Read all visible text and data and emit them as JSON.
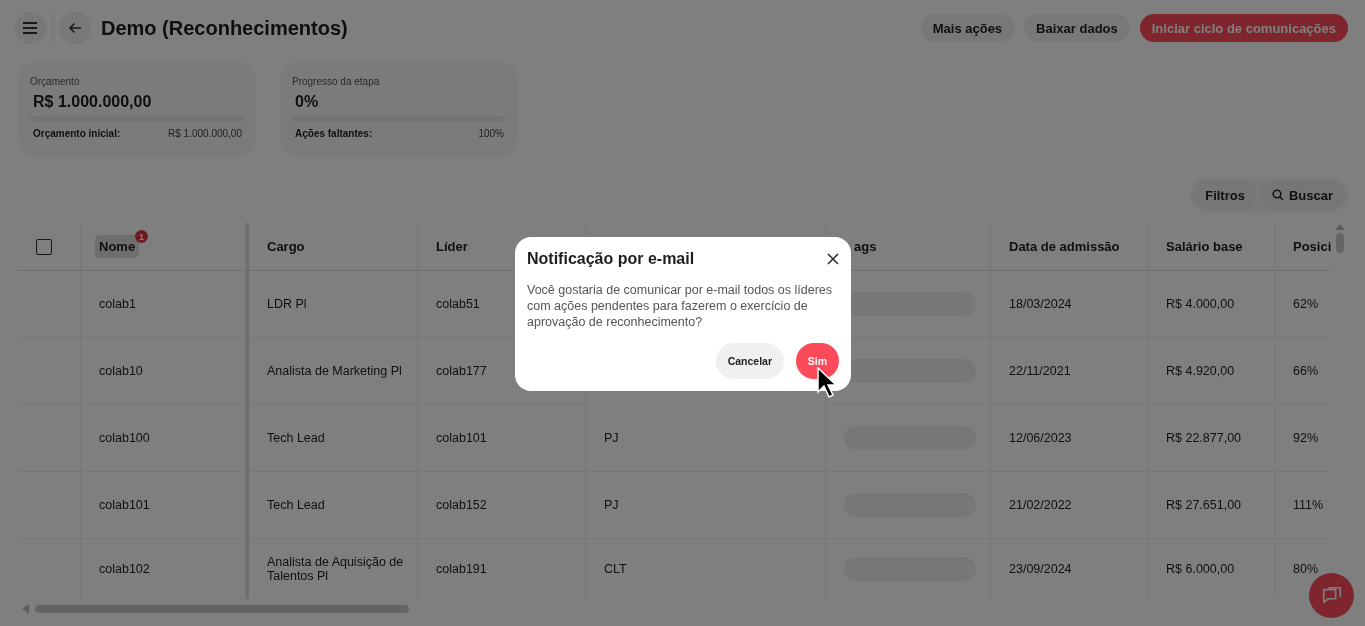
{
  "header": {
    "title": "Demo (Reconhecimentos)",
    "actions": [
      {
        "label": "Mais ações",
        "kind": "secondary"
      },
      {
        "label": "Baixar dados",
        "kind": "secondary"
      },
      {
        "label": "Iniciar ciclo de comunicações",
        "kind": "primary"
      }
    ]
  },
  "cards": [
    {
      "label": "Orçamento",
      "value": "R$ 1.000.000,00",
      "level": 0,
      "detail_label": "Orçamento inicial:",
      "detail_value": "R$ 1.000.000,00"
    },
    {
      "label": "Progresso da etapa",
      "value": "0%",
      "level": 0,
      "detail_label": "Ações faltantes:",
      "detail_value": "100%"
    }
  ],
  "toolbar": {
    "filters": "Filtros",
    "search": "Buscar"
  },
  "table": {
    "select_all_checked": false,
    "columns": [
      {
        "label": "Nome",
        "badge": "1",
        "kind": "text",
        "selected": true
      },
      {
        "label": "Cargo",
        "kind": "text",
        "selected": false
      },
      {
        "label": "Líder",
        "kind": "text",
        "selected": false
      },
      {
        "kind": "text",
        "selected": false
      },
      {
        "label": "ags",
        "kind": "tags",
        "selected": false
      },
      {
        "label": "Data de admissão",
        "kind": "text",
        "selected": false
      },
      {
        "label": "Salário base",
        "kind": "text",
        "selected": false
      },
      {
        "label": "Posici",
        "kind": "text",
        "selected": false
      }
    ],
    "rows": [
      {
        "cells": [
          "colab1",
          "LDR Pl",
          "colab51",
          null,
          null,
          "18/03/2024",
          "R$ 4.000,00",
          "62%"
        ]
      },
      {
        "cells": [
          "colab10",
          "Analista de Marketing Pl",
          "colab177",
          null,
          null,
          "22/11/2021",
          "R$ 4.920,00",
          "66%"
        ]
      },
      {
        "cells": [
          "colab100",
          "Tech Lead",
          "colab101",
          "PJ",
          null,
          "12/06/2023",
          "R$ 22.877,00",
          "92%"
        ]
      },
      {
        "cells": [
          "colab101",
          "Tech Lead",
          "colab152",
          "PJ",
          null,
          "21/02/2022",
          "R$ 27.651,00",
          "111%"
        ]
      },
      {
        "cells": [
          "colab102",
          "Analista de Aquisição de Talentos Pl",
          "colab191",
          "CLT",
          null,
          "23/09/2024",
          "R$ 6.000,00",
          "80%"
        ]
      }
    ]
  },
  "dialog": {
    "title": "Notificação por e-mail",
    "message": "Você gostaria de comunicar por e-mail todos os líderes com ações pendentes para fazerem o exercício de aprovação de reconhecimento?",
    "buttons": [
      {
        "label": "Cancelar",
        "kind": "secondary"
      },
      {
        "label": "Sim",
        "kind": "primary"
      }
    ]
  }
}
